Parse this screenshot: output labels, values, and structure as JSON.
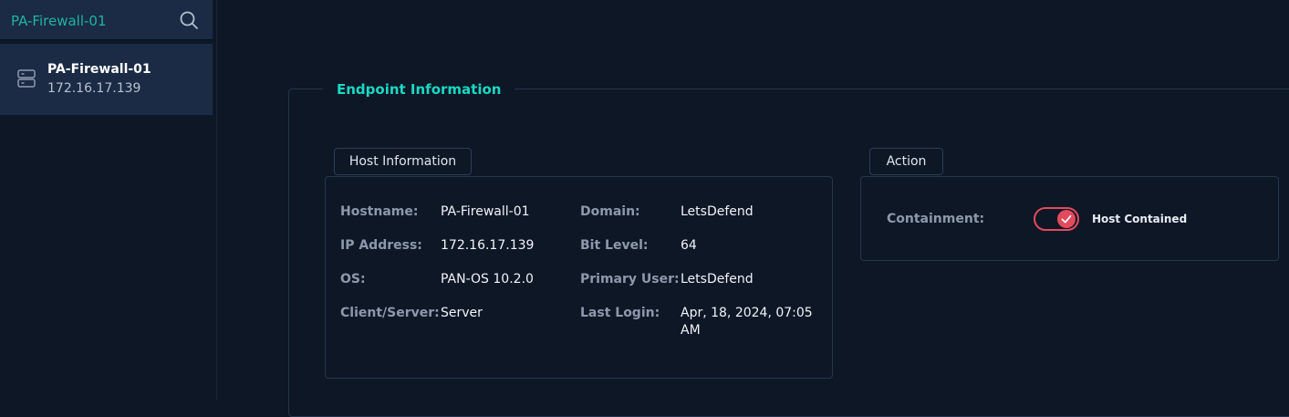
{
  "sidebar": {
    "search": {
      "value": "PA-Firewall-01",
      "icon": "search-icon"
    },
    "hosts": [
      {
        "name": "PA-Firewall-01",
        "ip": "172.16.17.139",
        "icon": "server-icon"
      }
    ]
  },
  "main": {
    "section_title": "Endpoint Information",
    "host_info": {
      "tab_label": "Host Information",
      "fields": {
        "hostname": {
          "label": "Hostname:",
          "value": "PA-Firewall-01"
        },
        "ip_address": {
          "label": "IP Address:",
          "value": "172.16.17.139"
        },
        "os": {
          "label": "OS:",
          "value": "PAN-OS 10.2.0"
        },
        "client_server": {
          "label": "Client/Server:",
          "value": "Server"
        },
        "domain": {
          "label": "Domain:",
          "value": "LetsDefend"
        },
        "bit_level": {
          "label": "Bit Level:",
          "value": "64"
        },
        "primary_user": {
          "label": "Primary User:",
          "value": "LetsDefend"
        },
        "last_login": {
          "label": "Last Login:",
          "value": "Apr, 18, 2024, 07:05 AM"
        }
      }
    },
    "action": {
      "tab_label": "Action",
      "containment_label": "Containment:",
      "containment_enabled": true,
      "containment_status": "Host Contained"
    }
  },
  "colors": {
    "background": "#0e1726",
    "sidebar_item": "#1b2b45",
    "accent_teal": "#1ad9c4",
    "toggle_red": "#e24b5c",
    "label_gray": "#8d99ab",
    "border": "#26354e"
  }
}
